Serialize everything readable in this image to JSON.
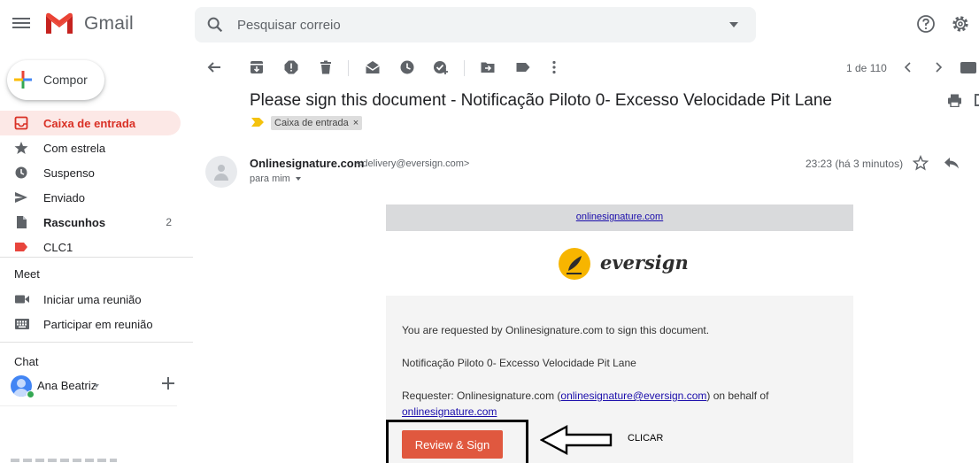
{
  "app": {
    "brand": "Gmail",
    "accent": "#d93025",
    "active_bg": "#fce8e6"
  },
  "search": {
    "placeholder": "Pesquisar correio"
  },
  "compose": {
    "label": "Compor"
  },
  "sidebar": {
    "items": [
      {
        "label": "Caixa de entrada",
        "icon": "inbox-icon",
        "active": true
      },
      {
        "label": "Com estrela",
        "icon": "star-icon"
      },
      {
        "label": "Suspenso",
        "icon": "clock-icon"
      },
      {
        "label": "Enviado",
        "icon": "send-icon"
      },
      {
        "label": "Rascunhos",
        "icon": "draft-icon",
        "count": "2",
        "bold": true
      },
      {
        "label": "CLC1",
        "icon": "label-icon",
        "color": "#e8453c"
      }
    ],
    "meet": {
      "title": "Meet",
      "items": [
        {
          "label": "Iniciar uma reunião",
          "icon": "video-icon"
        },
        {
          "label": "Participar em reunião",
          "icon": "keyboard-icon"
        }
      ]
    },
    "chat": {
      "title": "Chat",
      "user": "Ana Beatriz"
    }
  },
  "toolbar": {
    "pager": "1 de 110"
  },
  "message": {
    "subject": "Please sign this document - Notificação Piloto 0- Excesso Velocidade Pit Lane",
    "label": "Caixa de entrada",
    "label_remove": "×",
    "sender_name": "Onlinesignature.com",
    "sender_email": "<delivery@eversign.com>",
    "to": "para mim",
    "time": "23:23 (há 3 minutos)"
  },
  "email": {
    "top_link": "onlinesignature.com",
    "brand": "eversign",
    "line1": "You are requested by Onlinesignature.com to sign this document.",
    "line2": "Notificação Piloto 0- Excesso Velocidade Pit Lane",
    "requester_prefix": "Requester: Onlinesignature.com (",
    "requester_email": "onlinesignature@eversign.com",
    "requester_suffix": ") on behalf of",
    "behalf_link": "onlinesignature.com",
    "button": "Review & Sign",
    "button_color": "#e0583f"
  },
  "annotation": {
    "label": "CLICAR"
  }
}
